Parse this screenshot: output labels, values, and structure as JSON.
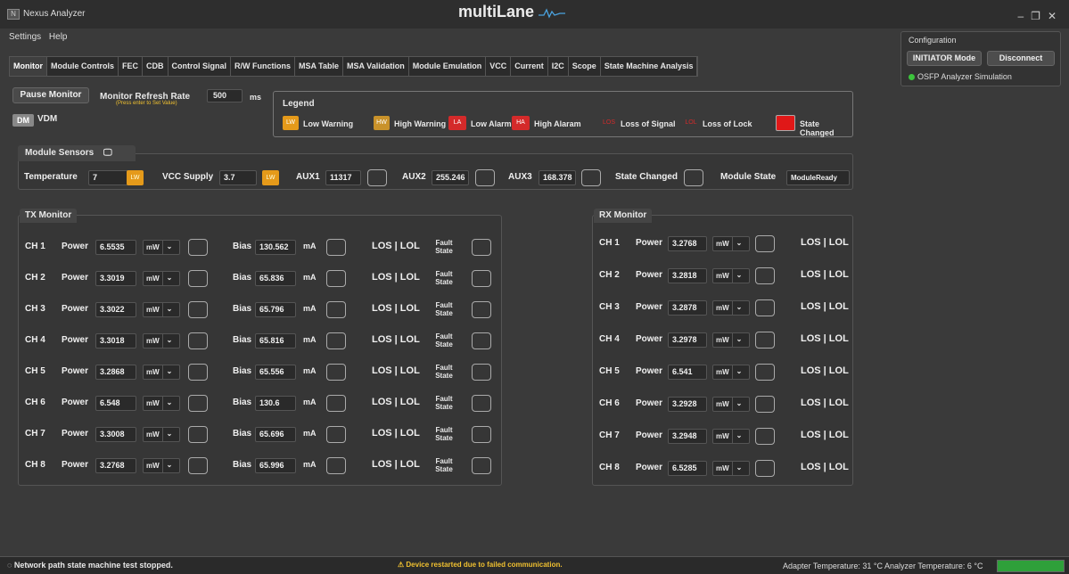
{
  "app": {
    "title": "Nexus Analyzer",
    "brand": "multiLane",
    "menu": [
      "Settings",
      "Help"
    ]
  },
  "tabs": [
    "Monitor",
    "Module Controls",
    "FEC",
    "CDB",
    "Control Signal",
    "R/W Functions",
    "MSA Table",
    "MSA Validation",
    "Module Emulation",
    "VCC",
    "Current",
    "I2C",
    "Scope",
    "State Machine Analysis"
  ],
  "active_tab": "Monitor",
  "config": {
    "label": "Configuration",
    "mode_button": "INITIATOR Mode",
    "disconnect_button": "Disconnect",
    "status": "OSFP Analyzer Simulation"
  },
  "monitor": {
    "pause_button": "Pause Monitor",
    "refresh_label": "Monitor Refresh Rate",
    "refresh_hint": "(Press enter to Set Value)",
    "refresh_value": "500",
    "refresh_unit": "ms",
    "dm_button": "DM",
    "vdm_button": "VDM"
  },
  "legend": {
    "title": "Legend",
    "items": [
      {
        "badge": "LW",
        "label": "Low Warning",
        "color": "#e59a1a"
      },
      {
        "badge": "HW",
        "label": "High Warning",
        "color": "#c9922a"
      },
      {
        "badge": "LA",
        "label": "Low Alarm",
        "color": "#d42a2a"
      },
      {
        "badge": "HA",
        "label": "High Alaram",
        "color": "#d42a2a"
      },
      {
        "badge": "LOS",
        "label": "Loss of Signal",
        "color": "#d42a2a"
      },
      {
        "badge": "LOL",
        "label": "Loss of Lock",
        "color": "#d42a2a"
      },
      {
        "badge": "",
        "label": "State Changed",
        "color": "#e01818"
      }
    ]
  },
  "sensors": {
    "title": "Module Sensors",
    "temperature_label": "Temperature",
    "temperature": "7",
    "temperature_flag": "LW",
    "vcc_label": "VCC Supply",
    "vcc": "3.7",
    "vcc_flag": "LW",
    "aux1_label": "AUX1",
    "aux1": "11317",
    "aux2_label": "AUX2",
    "aux2": "255.246",
    "aux3_label": "AUX3",
    "aux3": "168.378",
    "state_changed_label": "State Changed",
    "module_state_label": "Module State",
    "module_state": "ModuleReady"
  },
  "tx": {
    "title": "TX Monitor",
    "power_label": "Power",
    "bias_label": "Bias",
    "bias_unit": "mA",
    "unit": "mW",
    "los_lol": "LOS | LOL",
    "fault_state": [
      "Fault",
      "State"
    ],
    "channels": [
      {
        "ch": "CH 1",
        "power": "6.5535",
        "bias": "130.562"
      },
      {
        "ch": "CH 2",
        "power": "3.3019",
        "bias": "65.836"
      },
      {
        "ch": "CH 3",
        "power": "3.3022",
        "bias": "65.796"
      },
      {
        "ch": "CH 4",
        "power": "3.3018",
        "bias": "65.816"
      },
      {
        "ch": "CH 5",
        "power": "3.2868",
        "bias": "65.556"
      },
      {
        "ch": "CH 6",
        "power": "6.548",
        "bias": "130.6"
      },
      {
        "ch": "CH 7",
        "power": "3.3008",
        "bias": "65.696"
      },
      {
        "ch": "CH 8",
        "power": "3.2768",
        "bias": "65.996"
      }
    ]
  },
  "rx": {
    "title": "RX Monitor",
    "power_label": "Power",
    "unit": "mW",
    "los_lol": "LOS | LOL",
    "channels": [
      {
        "ch": "CH 1",
        "power": "3.2768"
      },
      {
        "ch": "CH 2",
        "power": "3.2818"
      },
      {
        "ch": "CH 3",
        "power": "3.2878"
      },
      {
        "ch": "CH 4",
        "power": "3.2978"
      },
      {
        "ch": "CH 5",
        "power": "6.541"
      },
      {
        "ch": "CH 6",
        "power": "3.2928"
      },
      {
        "ch": "CH 7",
        "power": "3.2948"
      },
      {
        "ch": "CH 8",
        "power": "6.5285"
      }
    ]
  },
  "status": {
    "left": "Network path state machine test stopped.",
    "middle": "Device restarted due to failed communication.",
    "right": "Adapter Temperature: 31 °C  Analyzer Temperature: 6 °C"
  }
}
